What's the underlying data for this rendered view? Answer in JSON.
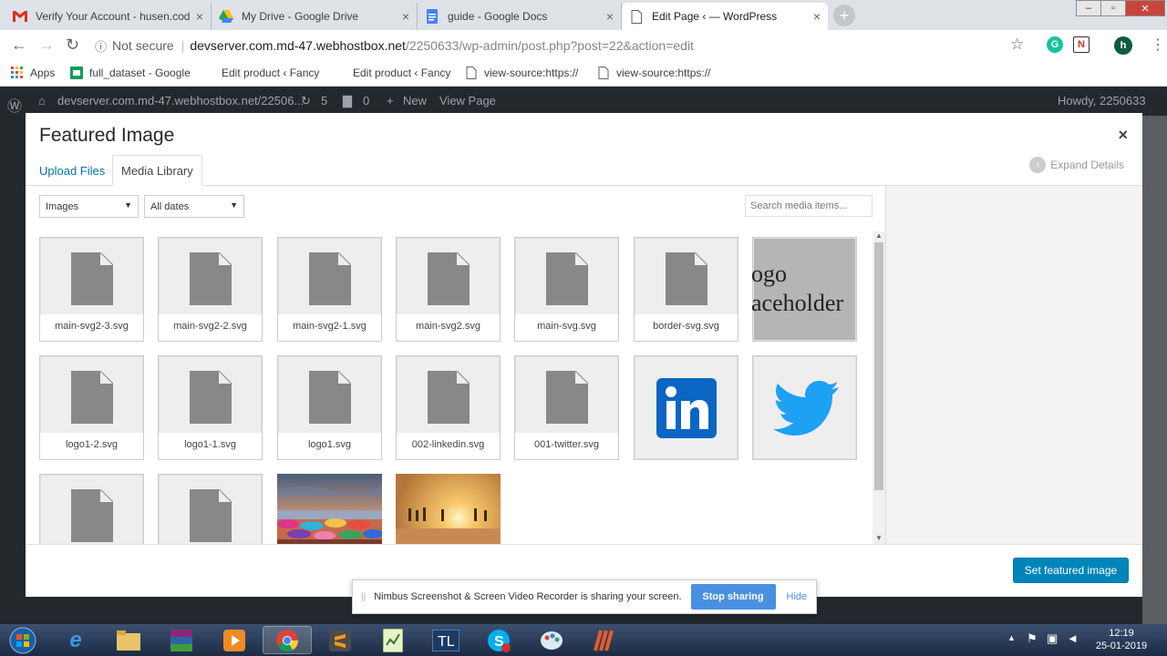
{
  "browser": {
    "tabs": [
      {
        "title": "Verify Your Account - husen.cod",
        "icon": "gmail-icon",
        "active": false
      },
      {
        "title": "My Drive - Google Drive",
        "icon": "google-drive-icon",
        "active": false
      },
      {
        "title": "guide - Google Docs",
        "icon": "google-docs-icon",
        "active": false
      },
      {
        "title": "Edit Page ‹ — WordPress",
        "icon": "page-icon",
        "active": true
      }
    ],
    "tab_close": "×",
    "new_tab": "+",
    "window_controls": {
      "minimize": "–",
      "restore": "▫",
      "close": "✕"
    },
    "security_label": "Not secure",
    "url_host": "devserver.com.md-47.webhostbox.net",
    "url_path": "/2250633/wp-admin/post.php?post=22&action=edit",
    "profile_initial": "h",
    "ext_n": "N",
    "bookmarks": [
      {
        "label": "Apps",
        "icon": "apps-grid-icon"
      },
      {
        "label": "full_dataset - Google",
        "icon": "sheets-icon"
      },
      {
        "label": "Edit product ‹ Fancy",
        "icon": "blank-icon"
      },
      {
        "label": "Edit product ‹ Fancy",
        "icon": "blank-icon"
      },
      {
        "label": "view-source:https://",
        "icon": "page-icon"
      },
      {
        "label": "view-source:https://",
        "icon": "page-icon"
      }
    ]
  },
  "wp_admin_bar": {
    "site": "devserver.com.md-47.webhostbox.net/22506...",
    "updates": "5",
    "comments": "0",
    "new": "New",
    "view": "View Page",
    "howdy": "Howdy, 2250633"
  },
  "modal": {
    "title": "Featured Image",
    "close": "×",
    "tabs": {
      "upload": "Upload Files",
      "library": "Media Library"
    },
    "expand_details": "Expand Details",
    "filter_type": "Images",
    "filter_date": "All dates",
    "search_placeholder": "Search media items...",
    "set_button": "Set featured image",
    "media": [
      {
        "name": "main-svg2-3.svg",
        "kind": "doc"
      },
      {
        "name": "main-svg2-2.svg",
        "kind": "doc"
      },
      {
        "name": "main-svg2-1.svg",
        "kind": "doc"
      },
      {
        "name": "main-svg2.svg",
        "kind": "doc"
      },
      {
        "name": "main-svg.svg",
        "kind": "doc"
      },
      {
        "name": "border-svg.svg",
        "kind": "doc"
      },
      {
        "name": "",
        "kind": "logo-placeholder",
        "text": "ogo aceholder"
      },
      {
        "name": "logo1-2.svg",
        "kind": "doc"
      },
      {
        "name": "logo1-1.svg",
        "kind": "doc"
      },
      {
        "name": "logo1.svg",
        "kind": "doc"
      },
      {
        "name": "002-linkedin.svg",
        "kind": "doc"
      },
      {
        "name": "001-twitter.svg",
        "kind": "doc"
      },
      {
        "name": "",
        "kind": "linkedin"
      },
      {
        "name": "",
        "kind": "twitter"
      },
      {
        "name": "",
        "kind": "doc"
      },
      {
        "name": "",
        "kind": "doc"
      },
      {
        "name": "",
        "kind": "beach-photo-1"
      },
      {
        "name": "",
        "kind": "beach-photo-2"
      }
    ]
  },
  "nimbus": {
    "message": "Nimbus Screenshot & Screen Video Recorder is sharing your screen.",
    "stop": "Stop sharing",
    "hide": "Hide"
  },
  "taskbar": {
    "time": "12:19",
    "date": "25-01-2019"
  },
  "colors": {
    "wp_blue": "#0073aa",
    "primary_button": "#0085ba",
    "admin_bar": "#23282d",
    "twitter": "#1da1f2",
    "linkedin": "#0a66c2"
  }
}
